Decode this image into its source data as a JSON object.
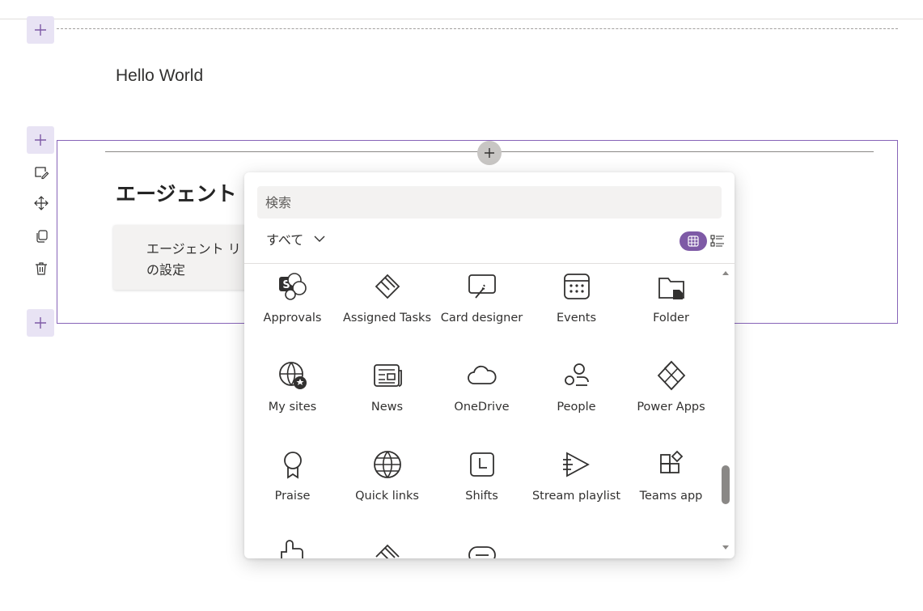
{
  "page": {
    "hello_text": "Hello World",
    "section_title": "エージェント",
    "card_text_line1": "エージェント リ",
    "card_text_line2": "の設定"
  },
  "picker": {
    "search_placeholder": "検索",
    "filter_label": "すべて",
    "items": [
      {
        "label": "Approvals",
        "icon": "approvals-icon"
      },
      {
        "label": "Assigned Tasks",
        "icon": "assigned-tasks-icon"
      },
      {
        "label": "Card designer",
        "icon": "card-designer-icon"
      },
      {
        "label": "Events",
        "icon": "events-icon"
      },
      {
        "label": "Folder",
        "icon": "folder-icon"
      },
      {
        "label": "My sites",
        "icon": "my-sites-icon"
      },
      {
        "label": "News",
        "icon": "news-icon"
      },
      {
        "label": "OneDrive",
        "icon": "onedrive-icon"
      },
      {
        "label": "People",
        "icon": "people-icon"
      },
      {
        "label": "Power Apps",
        "icon": "power-apps-icon"
      },
      {
        "label": "Praise",
        "icon": "praise-icon"
      },
      {
        "label": "Quick links",
        "icon": "quick-links-icon"
      },
      {
        "label": "Shifts",
        "icon": "shifts-icon"
      },
      {
        "label": "Stream playlist",
        "icon": "stream-playlist-icon"
      },
      {
        "label": "Teams app",
        "icon": "teams-app-icon"
      }
    ]
  },
  "colors": {
    "accent": "#7e5aa6",
    "section_border": "#8764b8",
    "add_button_bg": "#e8e3f4"
  }
}
